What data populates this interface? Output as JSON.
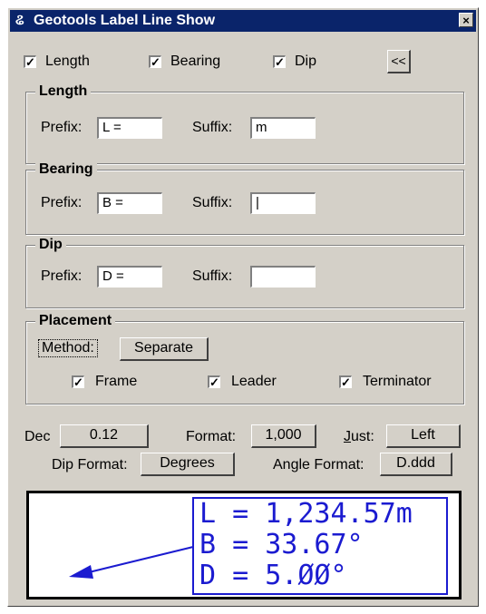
{
  "window": {
    "title": "Geotools Label Line Show",
    "close_label": "×"
  },
  "toggles": [
    {
      "label": "Length",
      "checked": true
    },
    {
      "label": "Bearing",
      "checked": true
    },
    {
      "label": "Dip",
      "checked": true
    }
  ],
  "collapse_button": "<<",
  "groups": {
    "length": {
      "title": "Length",
      "prefix_label": "Prefix:",
      "prefix": "L =",
      "suffix_label": "Suffix:",
      "suffix": "m"
    },
    "bearing": {
      "title": "Bearing",
      "prefix_label": "Prefix:",
      "prefix": "B =",
      "suffix_label": "Suffix:",
      "suffix": "|"
    },
    "dip": {
      "title": "Dip",
      "prefix_label": "Prefix:",
      "prefix": "D =",
      "suffix_label": "Suffix:",
      "suffix": ""
    }
  },
  "placement": {
    "title": "Placement",
    "method_label": "Method:",
    "method_value": "Separate",
    "options": [
      {
        "label": "Frame",
        "checked": true
      },
      {
        "label": "Leader",
        "checked": true
      },
      {
        "label": "Terminator",
        "checked": true
      }
    ]
  },
  "format": {
    "dec_label": "Dec",
    "dec_value": "0.12",
    "format_label": "Format:",
    "format_value": "1,000",
    "just_label_underlined": "J",
    "just_label_rest": "ust:",
    "just_value": "Left",
    "dip_format_label": "Dip Format:",
    "dip_format_value": "Degrees",
    "angle_format_label": "Angle Format:",
    "angle_format_value": "D.ddd"
  },
  "preview": {
    "lines": [
      "L = 1,234.57m",
      "B = 33.67°",
      "D = 5.ØØ°"
    ],
    "color": "#1b1bd0"
  },
  "colors": {
    "titlebar": "#0a246a",
    "face": "#d4d0c8"
  }
}
